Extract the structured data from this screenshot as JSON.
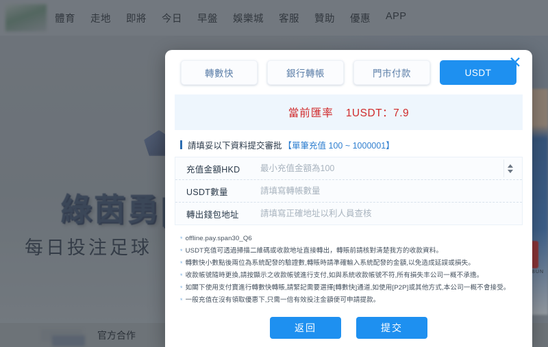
{
  "background": {
    "nav_items": [
      "體育",
      "走地",
      "即將",
      "今日",
      "早盤",
      "娛樂城",
      "客服",
      "贊助",
      "優惠",
      "APP"
    ],
    "hero_title": "綠茵勇[",
    "hero_subtitle": "每日投注足球",
    "footer_text": "官方合作",
    "badge_text": "BUN"
  },
  "modal": {
    "close_icon": "close-icon",
    "tabs": [
      {
        "label": "轉數快",
        "active": false
      },
      {
        "label": "銀行轉帳",
        "active": false
      },
      {
        "label": "門市付款",
        "active": false
      },
      {
        "label": "USDT",
        "active": true
      }
    ],
    "rate": {
      "label": "當前匯率",
      "value": "1USDT：7.9",
      "color": "#d02a2a"
    },
    "form_header": {
      "prefix": "請填妥以下資料提交審批",
      "highlight": "【單筆充值 100 ~ 1000001】"
    },
    "fields": [
      {
        "label": "充值金額HKD",
        "value": "",
        "placeholder": "最小充值金額為100",
        "spinner": true
      },
      {
        "label": "USDT數量",
        "value": "",
        "placeholder": "請填寫轉帳數量",
        "spinner": false
      },
      {
        "label": "轉出錢包地址",
        "value": "",
        "placeholder": "請填寫正確地址以利人員查核",
        "spinner": false
      }
    ],
    "notes": [
      "offline.pay.span30_Q6",
      "USDT充值可透過掃描二維碼或收款地址直接轉出，轉賬前請核對清楚我方的收款資料。",
      "轉數快小數點後兩位為系統配發的驗證數,轉賬時請準確輸入系統配發的金額,以免造成延誤或損失。",
      "收款帳號隨時更換,請按顯示之收款帳號進行支付,如與系統收款帳號不符,所有損失丰公司一概不承擔。",
      "如閣下使用支付寶進行轉數快轉賬,請緊記需要選擇[轉數快]通道,如使用[P2P]或其他方式,本公司一概不會接受。",
      "一般充值在沒有領取優惠下,只需一倍有效投注金額便可申請提款。"
    ],
    "buttons": [
      {
        "label": "返回",
        "name": "back-button"
      },
      {
        "label": "提交",
        "name": "submit-button"
      }
    ]
  }
}
